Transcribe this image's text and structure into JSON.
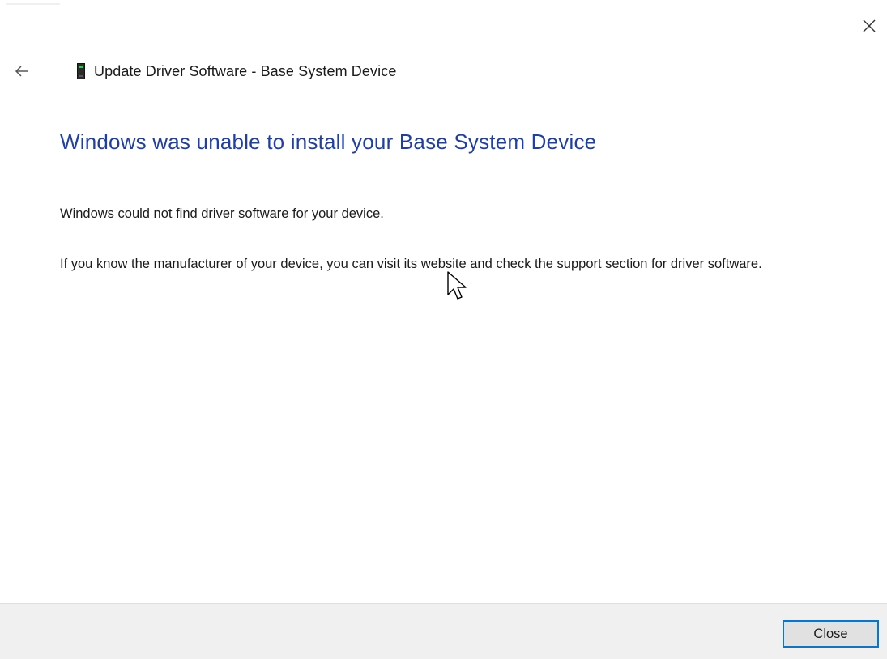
{
  "window": {
    "close_icon": "close-icon"
  },
  "header": {
    "back_icon": "back-arrow-icon",
    "device_icon": "device-icon",
    "title": "Update Driver Software - Base System Device"
  },
  "main": {
    "heading": "Windows was unable to install your Base System Device",
    "paragraph_1": "Windows could not find driver software for your device.",
    "paragraph_2": "If you know the manufacturer of your device, you can visit its website and check the support section for driver software."
  },
  "footer": {
    "close_label": "Close"
  },
  "colors": {
    "heading": "#1f3fa8",
    "footer_bg": "#f0f0f0",
    "button_border": "#0078d7"
  }
}
